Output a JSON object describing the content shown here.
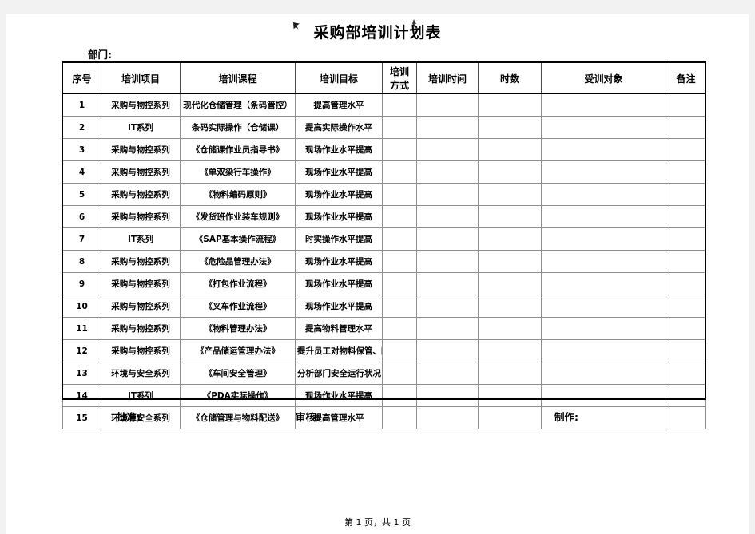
{
  "document": {
    "title": "采购部培训计划表",
    "department_label": "部门:"
  },
  "table": {
    "headers": {
      "no": "序号",
      "project": "培训项目",
      "course": "培训课程",
      "goal": "培训目标",
      "mode_line1": "培训",
      "mode_line2": "方式",
      "time": "培训时间",
      "hours": "时数",
      "audience": "受训对象",
      "remark": "备注"
    },
    "rows": [
      {
        "no": "1",
        "project": "采购与物控系列",
        "course": "现代化仓储管理（条码管控）",
        "goal": "提高管理水平",
        "mode": "",
        "time": "",
        "hours": "",
        "audience": "",
        "remark": ""
      },
      {
        "no": "2",
        "project": "IT系列",
        "course": "条码实际操作（仓储课）",
        "goal": "提高实际操作水平",
        "mode": "",
        "time": "",
        "hours": "",
        "audience": "",
        "remark": ""
      },
      {
        "no": "3",
        "project": "采购与物控系列",
        "course": "《仓储课作业员指导书》",
        "goal": "现场作业水平提高",
        "mode": "",
        "time": "",
        "hours": "",
        "audience": "",
        "remark": ""
      },
      {
        "no": "4",
        "project": "采购与物控系列",
        "course": "《单双梁行车操作》",
        "goal": "现场作业水平提高",
        "mode": "",
        "time": "",
        "hours": "",
        "audience": "",
        "remark": ""
      },
      {
        "no": "5",
        "project": "采购与物控系列",
        "course": "《物料编码原则》",
        "goal": "现场作业水平提高",
        "mode": "",
        "time": "",
        "hours": "",
        "audience": "",
        "remark": ""
      },
      {
        "no": "6",
        "project": "采购与物控系列",
        "course": "《发货班作业装车规则》",
        "goal": "现场作业水平提高",
        "mode": "",
        "time": "",
        "hours": "",
        "audience": "",
        "remark": ""
      },
      {
        "no": "7",
        "project": "IT系列",
        "course": "《SAP基本操作流程》",
        "goal": "时实操作水平提高",
        "mode": "",
        "time": "",
        "hours": "",
        "audience": "",
        "remark": ""
      },
      {
        "no": "8",
        "project": "采购与物控系列",
        "course": "《危险品管理办法》",
        "goal": "现场作业水平提高",
        "mode": "",
        "time": "",
        "hours": "",
        "audience": "",
        "remark": ""
      },
      {
        "no": "9",
        "project": "采购与物控系列",
        "course": "《打包作业流程》",
        "goal": "现场作业水平提高",
        "mode": "",
        "time": "",
        "hours": "",
        "audience": "",
        "remark": ""
      },
      {
        "no": "10",
        "project": "采购与物控系列",
        "course": "《叉车作业流程》",
        "goal": "现场作业水平提高",
        "mode": "",
        "time": "",
        "hours": "",
        "audience": "",
        "remark": ""
      },
      {
        "no": "11",
        "project": "采购与物控系列",
        "course": "《物料管理办法》",
        "goal": "提高物料管理水平",
        "mode": "",
        "time": "",
        "hours": "",
        "audience": "",
        "remark": ""
      },
      {
        "no": "12",
        "project": "采购与物控系列",
        "course": "《产品储运管理办法》",
        "goal": "提升员工对物料保管、防护、储存管控水",
        "mode": "",
        "time": "",
        "hours": "",
        "audience": "",
        "remark": ""
      },
      {
        "no": "13",
        "project": "环境与安全系列",
        "course": "《车间安全管理》",
        "goal": "分析部门安全运行状况",
        "mode": "",
        "time": "",
        "hours": "",
        "audience": "",
        "remark": ""
      },
      {
        "no": "14",
        "project": "IT系列",
        "course": "《PDA实际操作》",
        "goal": "现场作业水平提高",
        "mode": "",
        "time": "",
        "hours": "",
        "audience": "",
        "remark": ""
      },
      {
        "no": "15",
        "project": "环境与安全系列",
        "course": "《仓储管理与物料配送》",
        "goal": "提高管理水平",
        "mode": "",
        "time": "",
        "hours": "",
        "audience": "",
        "remark": ""
      }
    ]
  },
  "signatures": {
    "approve": "批准:",
    "review": "审核:",
    "make": "制作:"
  },
  "footer": {
    "page_info": "第 1 页，共 1 页"
  }
}
